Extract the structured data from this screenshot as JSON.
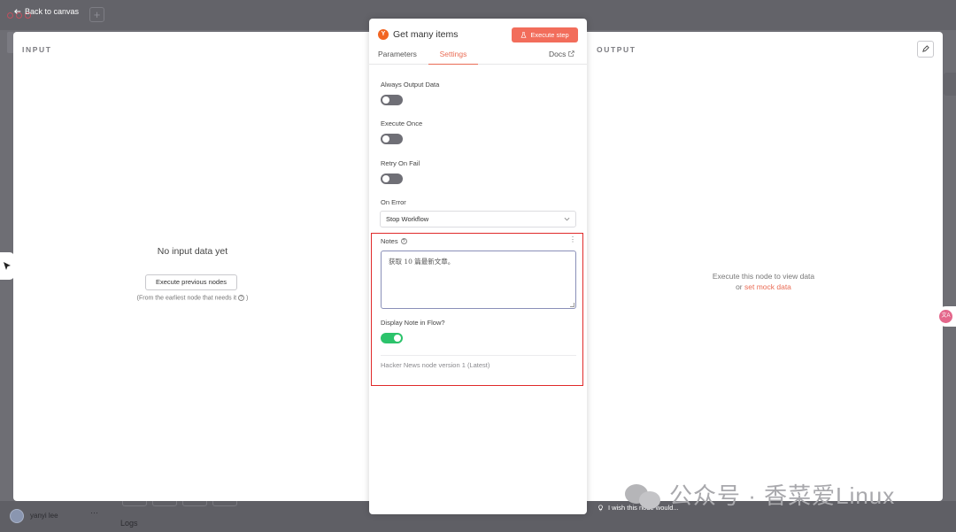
{
  "topbar": {
    "back_label": "Back to canvas"
  },
  "input_panel": {
    "title": "INPUT",
    "empty_title": "No input data yet",
    "execute_previous_label": "Execute previous nodes",
    "helper_text": "(From the earliest node that needs it"
  },
  "output_panel": {
    "title": "OUTPUT",
    "empty_text": "Execute this node to view data",
    "or_text": "or",
    "mock_link": "set mock data"
  },
  "node": {
    "icon_letter": "Y",
    "icon_color": "#f26522",
    "title": "Get many items",
    "execute_label": "Execute step",
    "execute_color": "#f26d5b",
    "tabs": {
      "parameters": "Parameters",
      "settings": "Settings",
      "docs": "Docs"
    },
    "settings": {
      "always_output_label": "Always Output Data",
      "always_output_on": false,
      "execute_once_label": "Execute Once",
      "execute_once_on": false,
      "retry_label": "Retry On Fail",
      "retry_on": false,
      "on_error_label": "On Error",
      "on_error_value": "Stop Workflow",
      "notes_label": "Notes",
      "notes_value": "获取 10 篇最新文章。",
      "display_note_label": "Display Note in Flow?",
      "display_note_on": true,
      "version_text": "Hacker News node version 1 (Latest)"
    }
  },
  "footer": {
    "user_name": "yanyi lee",
    "user_more": "···",
    "logs_label": "Logs",
    "wish_text": "I wish this node would..."
  },
  "watermark": {
    "text": "公众号 · 香菜爱Linux"
  },
  "colors": {
    "accent": "#ea6c55",
    "toggle_on": "#2cc36b",
    "toggle_off": "#6f6f76",
    "highlight": "#e02a2a"
  }
}
